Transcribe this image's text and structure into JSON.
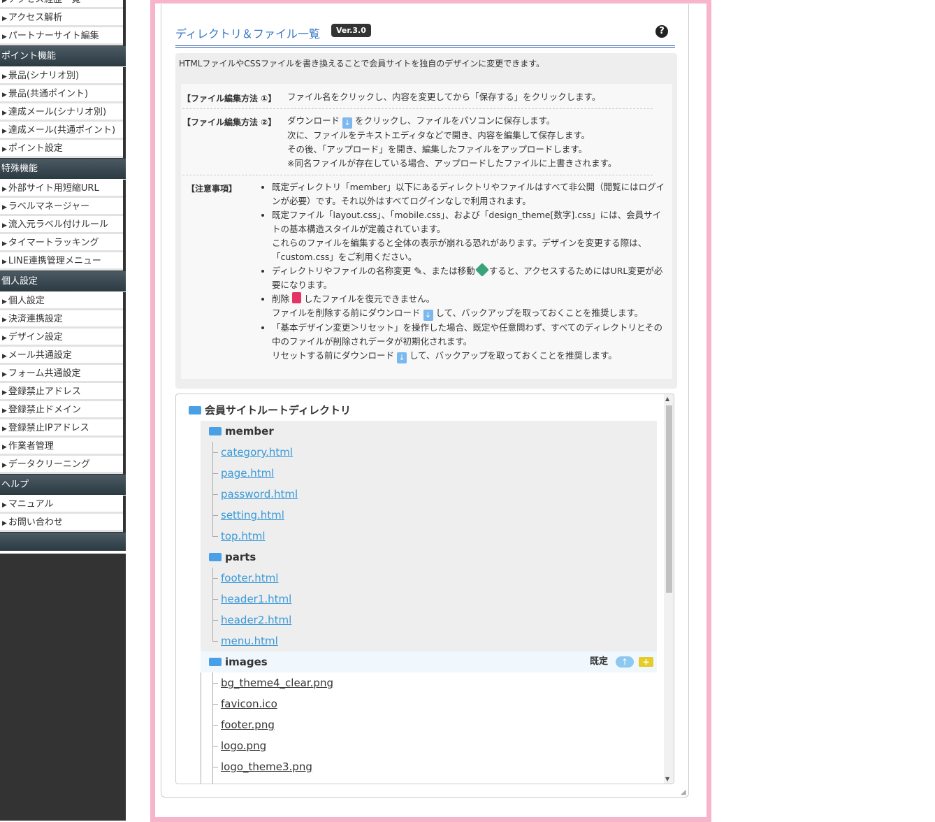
{
  "sidebar": {
    "top_items": [
      "アクセス経歴一覧",
      "アクセス解析",
      "パートナーサイト編集"
    ],
    "sections": [
      {
        "heading": "ポイント機能",
        "items": [
          "景品(シナリオ別)",
          "景品(共通ポイント)",
          "達成メール(シナリオ別)",
          "達成メール(共通ポイント)",
          "ポイント設定"
        ]
      },
      {
        "heading": "特殊機能",
        "items": [
          "外部サイト用短縮URL",
          "ラベルマネージャー",
          "流入元ラベル付けルール",
          "タイマートラッキング",
          "LINE連携管理メニュー"
        ]
      },
      {
        "heading": "個人設定",
        "items": [
          "個人設定",
          "決済連携設定",
          "デザイン設定",
          "メール共通設定",
          "フォーム共通設定",
          "登録禁止アドレス",
          "登録禁止ドメイン",
          "登録禁止IPアドレス",
          "作業者管理",
          "データクリーニング"
        ]
      },
      {
        "heading": "ヘルプ",
        "items": [
          "マニュアル",
          "お問い合わせ"
        ]
      }
    ]
  },
  "panel": {
    "title": "ディレクトリ＆ファイル一覧",
    "version": "Ver.3.0",
    "help_icon": "?",
    "intro": "HTMLファイルやCSSファイルを書き換えることで会員サイトを独自のデザインに変更できます。",
    "method1_label": "【ファイル編集方法 ①】",
    "method1_text": "ファイル名をクリックし、内容を変更してから「保存する」をクリックします。",
    "method2_label": "【ファイル編集方法 ②】",
    "method2_line1a": "ダウンロード",
    "method2_line1b": "をクリックし、ファイルをパソコンに保存します。",
    "method2_line2": "次に、ファイルをテキストエディタなどで開き、内容を編集して保存します。",
    "method2_line3": "その後、「アップロード」を開き、編集したファイルをアップロードします。",
    "method2_line4": "※同名ファイルが存在している場合、アップロードしたファイルに上書きされます。",
    "notes_label": "【注意事項】",
    "note1": "既定ディレクトリ「member」以下にあるディレクトリやファイルはすべて非公開（閲覧にはログインが必要）です。それ以外はすべてログインなしで利用されます。",
    "note2a": "既定ファイル「layout.css」、「mobile.css」、および「design_theme[数字].css」には、会員サイトの基本構造スタイルが定義されています。",
    "note2b": "これらのファイルを編集すると全体の表示が崩れる恐れがあります。デザインを変更する際は、「custom.css」をご利用ください。",
    "note3a": "ディレクトリやファイルの名称変更",
    "note3b": "、または移動",
    "note3c": "すると、アクセスするためにはURL変更が必要になります。",
    "note4a": "削除",
    "note4b": "したファイルを復元できません。",
    "note4c": "ファイルを削除する前にダウンロード",
    "note4d": "して、バックアップを取っておくことを推奨します。",
    "note5a": "「基本デザイン変更＞リセット」を操作した場合、既定や任意問わず、すべてのディレクトリとその中のファイルが削除されデータが初期化されます。",
    "note5b": "リセットする前にダウンロード",
    "note5c": "して、バックアップを取っておくことを推奨します。"
  },
  "tree": {
    "root": "会員サイトルートディレクトリ",
    "member": {
      "name": "member",
      "files": [
        "category.html",
        "page.html",
        "password.html",
        "setting.html",
        "top.html"
      ]
    },
    "parts": {
      "name": "parts",
      "files": [
        "footer.html",
        "header1.html",
        "header2.html",
        "menu.html"
      ]
    },
    "images": {
      "name": "images",
      "badge": "既定",
      "files": [
        "bg_theme4_clear.png",
        "favicon.ico",
        "footer.png",
        "logo.png",
        "logo_theme3.png"
      ]
    }
  },
  "colors": {
    "accent": "#3a78c8",
    "link": "#3a9ad9",
    "highlight_border": "#f8b4cb",
    "sidebar_bg": "#333333"
  }
}
